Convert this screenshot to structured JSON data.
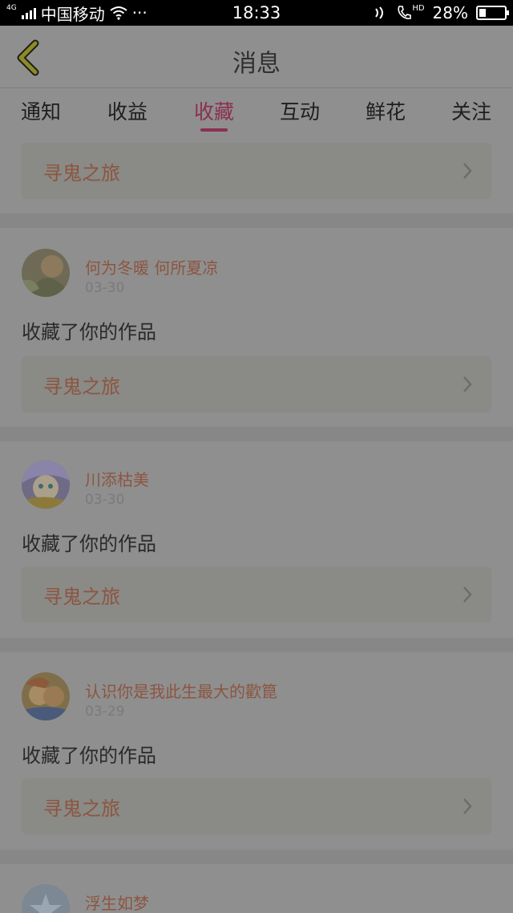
{
  "status_bar": {
    "network": "4G",
    "carrier": "中国移动",
    "more": "···",
    "time": "18:33",
    "battery": "28%",
    "battery_level": 0.28,
    "hd": "HD"
  },
  "header": {
    "title": "消息",
    "back_icon": "chevron-left-icon"
  },
  "tabs": [
    {
      "label": "通知"
    },
    {
      "label": "收益"
    },
    {
      "label": "收藏",
      "active": true
    },
    {
      "label": "互动"
    },
    {
      "label": "鲜花"
    },
    {
      "label": "关注"
    }
  ],
  "first_card": {
    "title": "寻鬼之旅"
  },
  "messages": [
    {
      "user": "何为冬暖 何所夏凉",
      "date": "03-30",
      "action": "收藏了你的作品",
      "work": "寻鬼之旅"
    },
    {
      "user": "川添枯美",
      "date": "03-30",
      "action": "收藏了你的作品",
      "work": "寻鬼之旅"
    },
    {
      "user": "认识你是我此生最大的歡箟",
      "date": "03-29",
      "action": "收藏了你的作品",
      "work": "寻鬼之旅"
    },
    {
      "user": "浮生如梦"
    }
  ],
  "colors": {
    "accent": "#8a2f52",
    "link_text": "#8c5540",
    "background": "#8f8f8f"
  }
}
